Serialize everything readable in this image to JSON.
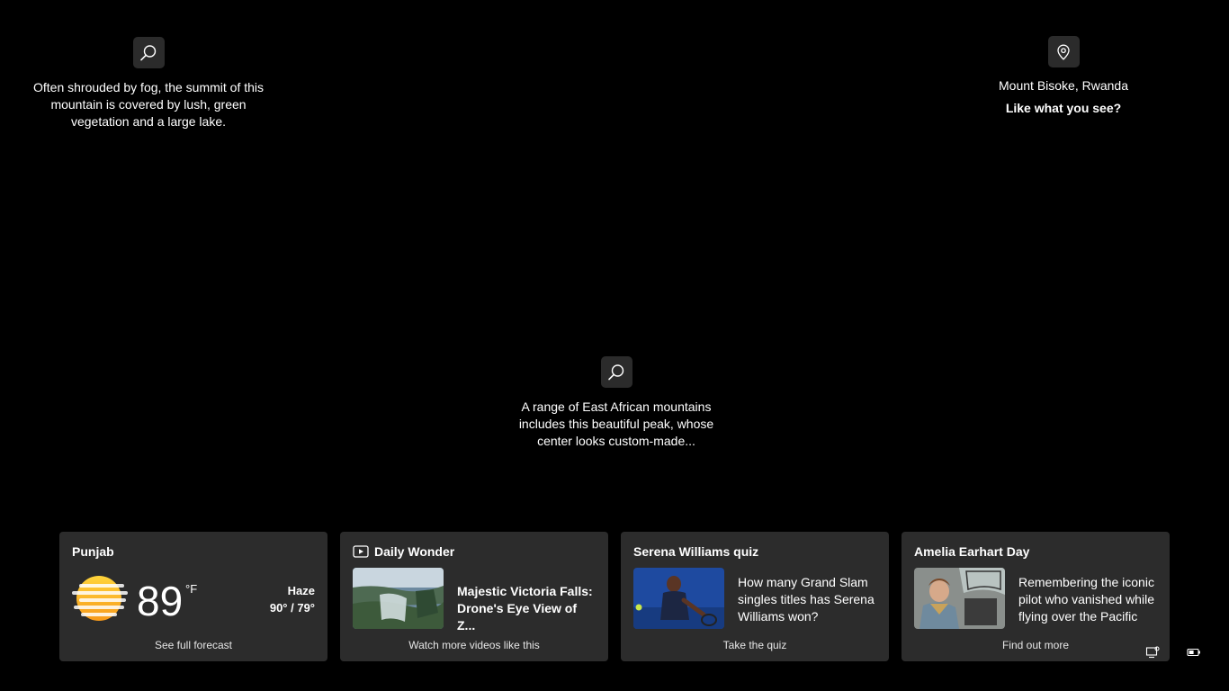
{
  "hotspots": {
    "left": {
      "text": "Often shrouded by fog, the summit of this mountain is covered by lush, green vegetation and a large lake.",
      "icon": "search-icon"
    },
    "center": {
      "text": "A range of East African mountains includes this beautiful peak, whose center looks custom-made...",
      "icon": "search-icon"
    },
    "right": {
      "location": "Mount Bisoke, Rwanda",
      "cta": "Like what you see?",
      "icon": "location-pin-icon"
    }
  },
  "cards": {
    "weather": {
      "title": "Punjab",
      "temp": "89",
      "unit": "°F",
      "condition": "Haze",
      "range": "90° / 79°",
      "footer": "See full forecast",
      "icon": "haze-sun-icon"
    },
    "wonder": {
      "title": "Daily Wonder",
      "headline": "Majestic Victoria Falls: Drone's Eye View of Z...",
      "footer": "Watch more videos like this",
      "icon": "video-icon"
    },
    "quiz": {
      "title": "Serena Williams quiz",
      "body": "How many Grand Slam singles titles has Serena Williams won?",
      "footer": "Take the quiz"
    },
    "earhart": {
      "title": "Amelia Earhart Day",
      "body": "Remembering the iconic pilot who vanished while flying over the Pacific",
      "footer": "Find out more"
    }
  },
  "tray": {
    "icons": [
      "network-icon",
      "battery-icon"
    ]
  }
}
